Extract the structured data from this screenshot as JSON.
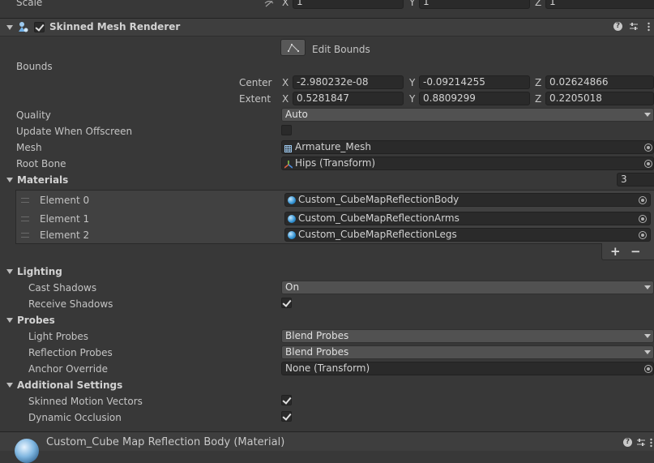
{
  "scale_row": {
    "label": "Scale",
    "x_label": "X",
    "x": "1",
    "y_label": "Y",
    "y": "1",
    "z_label": "Z",
    "z": "1"
  },
  "component": {
    "title": "Skinned Mesh Renderer",
    "enabled": true,
    "edit_bounds_label": "Edit Bounds"
  },
  "bounds": {
    "label": "Bounds",
    "center_label": "Center",
    "center": {
      "x": "-2.980232e-08",
      "y": "-0.09214255",
      "z": "0.02624866"
    },
    "extent_label": "Extent",
    "extent": {
      "x": "0.5281847",
      "y": "0.8809299",
      "z": "0.2205018"
    },
    "x_label": "X",
    "y_label": "Y",
    "z_label": "Z"
  },
  "quality": {
    "label": "Quality",
    "value": "Auto"
  },
  "update_offscreen": {
    "label": "Update When Offscreen",
    "checked": false
  },
  "mesh": {
    "label": "Mesh",
    "value": "Armature_Mesh"
  },
  "root_bone": {
    "label": "Root Bone",
    "value": "Hips (Transform)"
  },
  "materials": {
    "label": "Materials",
    "count": "3",
    "elements": [
      {
        "label": "Element 0",
        "value": "Custom_CubeMapReflectionBody"
      },
      {
        "label": "Element 1",
        "value": "Custom_CubeMapReflectionArms"
      },
      {
        "label": "Element 2",
        "value": "Custom_CubeMapReflectionLegs"
      }
    ],
    "add_label": "+",
    "remove_label": "−"
  },
  "lighting": {
    "label": "Lighting",
    "cast_shadows_label": "Cast Shadows",
    "cast_shadows_value": "On",
    "receive_shadows_label": "Receive Shadows",
    "receive_shadows_checked": true
  },
  "probes": {
    "label": "Probes",
    "light_probes_label": "Light Probes",
    "light_probes_value": "Blend Probes",
    "reflection_probes_label": "Reflection Probes",
    "reflection_probes_value": "Blend Probes",
    "anchor_override_label": "Anchor Override",
    "anchor_override_value": "None (Transform)"
  },
  "additional": {
    "label": "Additional Settings",
    "skinned_motion_label": "Skinned Motion Vectors",
    "skinned_motion_checked": true,
    "dynamic_occlusion_label": "Dynamic Occlusion",
    "dynamic_occlusion_checked": true
  },
  "material_footer": {
    "title": "Custom_Cube Map Reflection Body (Material)"
  },
  "icons": {
    "help": "help-icon",
    "presets": "presets-icon",
    "more": "more-vertical-icon"
  },
  "colors": {
    "background": "#383838",
    "header": "#3e3e3e",
    "field": "#2a2a2a",
    "accent": "#3a8fd0"
  }
}
